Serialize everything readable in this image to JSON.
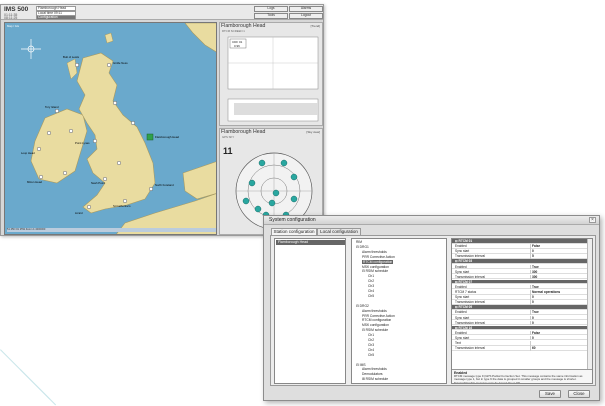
{
  "app": {
    "title": "IMS 500",
    "clocks": [
      "01:11:35",
      "08:11:25"
    ],
    "header_fields": [
      "Flamborough Head",
      "Local time 09:11"
    ],
    "header_status": "Configuration",
    "buttons": [
      "Logs",
      "Alarms",
      "Tools",
      "Logout"
    ]
  },
  "map": {
    "corner_label": "Map / Gis",
    "status_text": "51 45N 01 25W  Zoom 1:4000000",
    "station_labels": [
      "Flamborough Head",
      "Girdle Ness",
      "Butt of Lewis",
      "Point Lynas",
      "Lizard",
      "Nash Point",
      "St Catherine's",
      "North Foreland",
      "Tory Island",
      "Loop Head",
      "Mizen Head"
    ]
  },
  "panel_graph": {
    "title": "Flamborough Head",
    "subtitle": "RTCM SCREEN 1",
    "right_label": "[Trend]",
    "box_label": "CDF 01",
    "box_value": "0.96"
  },
  "panel_sky": {
    "title": "Flamborough Head",
    "subtitle": "GPS SKY",
    "right_label": "[Sky view]",
    "count": "11"
  },
  "dialog": {
    "title": "System configuration",
    "close_glyph": "×",
    "tabs": [
      "Station configuration",
      "Local configuration"
    ],
    "station": "Flamborough Head",
    "tree": [
      {
        "label": "RIM",
        "indent": 0,
        "sel": false
      },
      {
        "label": "⊟ DRG1",
        "indent": 0,
        "sel": false
      },
      {
        "label": "Alarm thresholds",
        "indent": 2,
        "sel": false
      },
      {
        "label": "PRR Corrective Action",
        "indent": 2,
        "sel": false
      },
      {
        "label": "RTCM configuration",
        "indent": 2,
        "sel": true
      },
      {
        "label": "MSK configuration",
        "indent": 2,
        "sel": false
      },
      {
        "label": "⊟ RSIM schedule",
        "indent": 2,
        "sel": false
      },
      {
        "label": "Ch1",
        "indent": 4,
        "sel": false
      },
      {
        "label": "Ch2",
        "indent": 4,
        "sel": false
      },
      {
        "label": "Ch3",
        "indent": 4,
        "sel": false
      },
      {
        "label": "Ch4",
        "indent": 4,
        "sel": false
      },
      {
        "label": "Ch5",
        "indent": 4,
        "sel": false
      },
      {
        "label": "",
        "indent": 0,
        "sel": false
      },
      {
        "label": "⊟ DRG2",
        "indent": 0,
        "sel": false
      },
      {
        "label": "Alarm thresholds",
        "indent": 2,
        "sel": false
      },
      {
        "label": "PRR Corrective Action",
        "indent": 2,
        "sel": false
      },
      {
        "label": "RTCM configuration",
        "indent": 2,
        "sel": false
      },
      {
        "label": "MSK configuration",
        "indent": 2,
        "sel": false
      },
      {
        "label": "⊟ RSIM schedule",
        "indent": 2,
        "sel": false
      },
      {
        "label": "Ch1",
        "indent": 4,
        "sel": false
      },
      {
        "label": "Ch2",
        "indent": 4,
        "sel": false
      },
      {
        "label": "Ch3",
        "indent": 4,
        "sel": false
      },
      {
        "label": "Ch4",
        "indent": 4,
        "sel": false
      },
      {
        "label": "Ch5",
        "indent": 4,
        "sel": false
      },
      {
        "label": "",
        "indent": 0,
        "sel": false
      },
      {
        "label": "⊟ IMS",
        "indent": 0,
        "sel": false
      },
      {
        "label": "Alarm thresholds",
        "indent": 2,
        "sel": false
      },
      {
        "label": "Demodulators",
        "indent": 2,
        "sel": false
      },
      {
        "label": "⊞ RSIM schedule",
        "indent": 2,
        "sel": false
      }
    ],
    "properties": [
      {
        "k": "⊟ RTCM 01",
        "v": "",
        "sec": true
      },
      {
        "k": "Enabled",
        "v": "False",
        "sec": false
      },
      {
        "k": "Sync start",
        "v": "0",
        "sec": false
      },
      {
        "k": "Transmission interval",
        "v": "5",
        "sec": false
      },
      {
        "k": "⊟ RTCM 03",
        "v": "",
        "sec": true
      },
      {
        "k": "Enabled",
        "v": "True",
        "sec": false
      },
      {
        "k": "Sync start",
        "v": "300",
        "sec": false
      },
      {
        "k": "Transmission interval",
        "v": "300",
        "sec": false
      },
      {
        "k": "⊟ RTCM 07",
        "v": "",
        "sec": true
      },
      {
        "k": "Enabled",
        "v": "True",
        "sec": false
      },
      {
        "k": "RTCM 7 status",
        "v": "Normal operations",
        "sec": false
      },
      {
        "k": "Sync start",
        "v": "0",
        "sec": false
      },
      {
        "k": "Transmission interval",
        "v": "0",
        "sec": false
      },
      {
        "k": "⊟ RTCM 09",
        "v": "",
        "sec": true
      },
      {
        "k": "Enabled",
        "v": "True",
        "sec": false
      },
      {
        "k": "Sync start",
        "v": "0",
        "sec": false
      },
      {
        "k": "Transmission interval",
        "v": "0",
        "sec": false
      },
      {
        "k": "⊟ RTCM 16",
        "v": "",
        "sec": true
      },
      {
        "k": "Enabled",
        "v": "False",
        "sec": false
      },
      {
        "k": "Sync start",
        "v": "0",
        "sec": false
      },
      {
        "k": "Text",
        "v": "",
        "sec": false
      },
      {
        "k": "Transmission interval",
        "v": "60",
        "sec": false
      }
    ],
    "desc_title": "Enabled",
    "desc_text": "RTCM message type 9 (GPS Partial Correction Set. This message contains the same information as message type 1, but in type 9 the data is grouped in smaller groups and the message is shorter. Transmitting this message may be turned On or Off.",
    "save_label": "Save",
    "close_label": "Close"
  }
}
